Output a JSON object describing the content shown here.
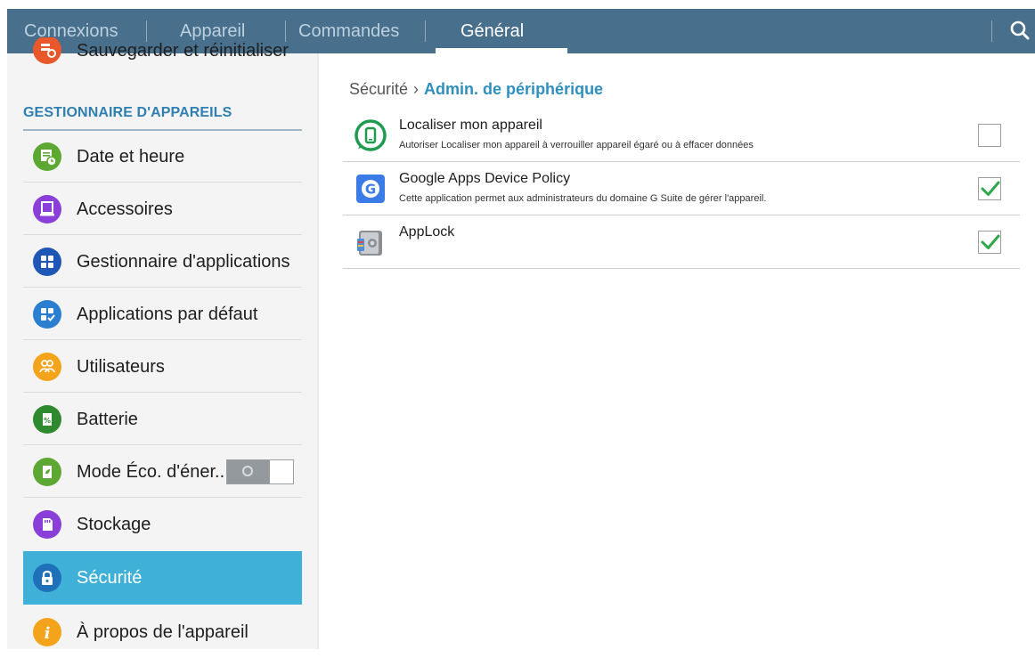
{
  "topbar": {
    "tabs": [
      {
        "label": "Connexions"
      },
      {
        "label": "Appareil"
      },
      {
        "label": "Commandes"
      },
      {
        "label": "Général"
      }
    ],
    "active_tab": "Général",
    "search_icon": "search-icon",
    "color": "#48708d"
  },
  "sidebar": {
    "partial_top_item": "Sauvegarder et réinitialiser",
    "section_header": "GESTIONNAIRE D'APPAREILS",
    "items": [
      {
        "label": "Date et heure",
        "icon": "calendar-clock-icon",
        "color": "#5ca832"
      },
      {
        "label": "Accessoires",
        "icon": "accessory-icon",
        "color": "#8a3fd8"
      },
      {
        "label": "Gestionnaire d'applications",
        "icon": "app-grid-icon",
        "color": "#1e57b5"
      },
      {
        "label": "Applications par défaut",
        "icon": "default-apps-icon",
        "color": "#2a7fd0"
      },
      {
        "label": "Utilisateurs",
        "icon": "users-icon",
        "color": "#f3a41b"
      },
      {
        "label": "Batterie",
        "icon": "battery-icon",
        "color": "#2f8a2f"
      },
      {
        "label": "Mode Éco. d'éner..",
        "icon": "eco-mode-icon",
        "color": "#5ca832",
        "toggle_on": false
      },
      {
        "label": "Stockage",
        "icon": "storage-icon",
        "color": "#8a3fd8"
      },
      {
        "label": "Sécurité",
        "icon": "lock-icon",
        "color": "#1e70b8",
        "selected": true
      },
      {
        "label": "À propos de l'appareil",
        "icon": "info-icon",
        "color": "#f3a41b"
      }
    ],
    "selected_color": "#3fb0d8"
  },
  "main": {
    "breadcrumb": {
      "parent": "Sécurité",
      "separator": "›",
      "current": "Admin. de périphérique"
    },
    "admins": [
      {
        "title": "Localiser mon appareil",
        "subtitle": "Autoriser Localiser mon appareil à verrouiller appareil égaré ou à effacer données",
        "icon": "find-my-device-icon",
        "checked": false
      },
      {
        "title": "Google Apps Device Policy",
        "subtitle": "Cette application permet aux administrateurs du domaine G Suite de gérer l'appareil.",
        "icon": "google-device-policy-icon",
        "checked": true
      },
      {
        "title": "AppLock",
        "subtitle": "",
        "icon": "applock-icon",
        "checked": true
      }
    ],
    "check_color": "#2ea84a"
  }
}
